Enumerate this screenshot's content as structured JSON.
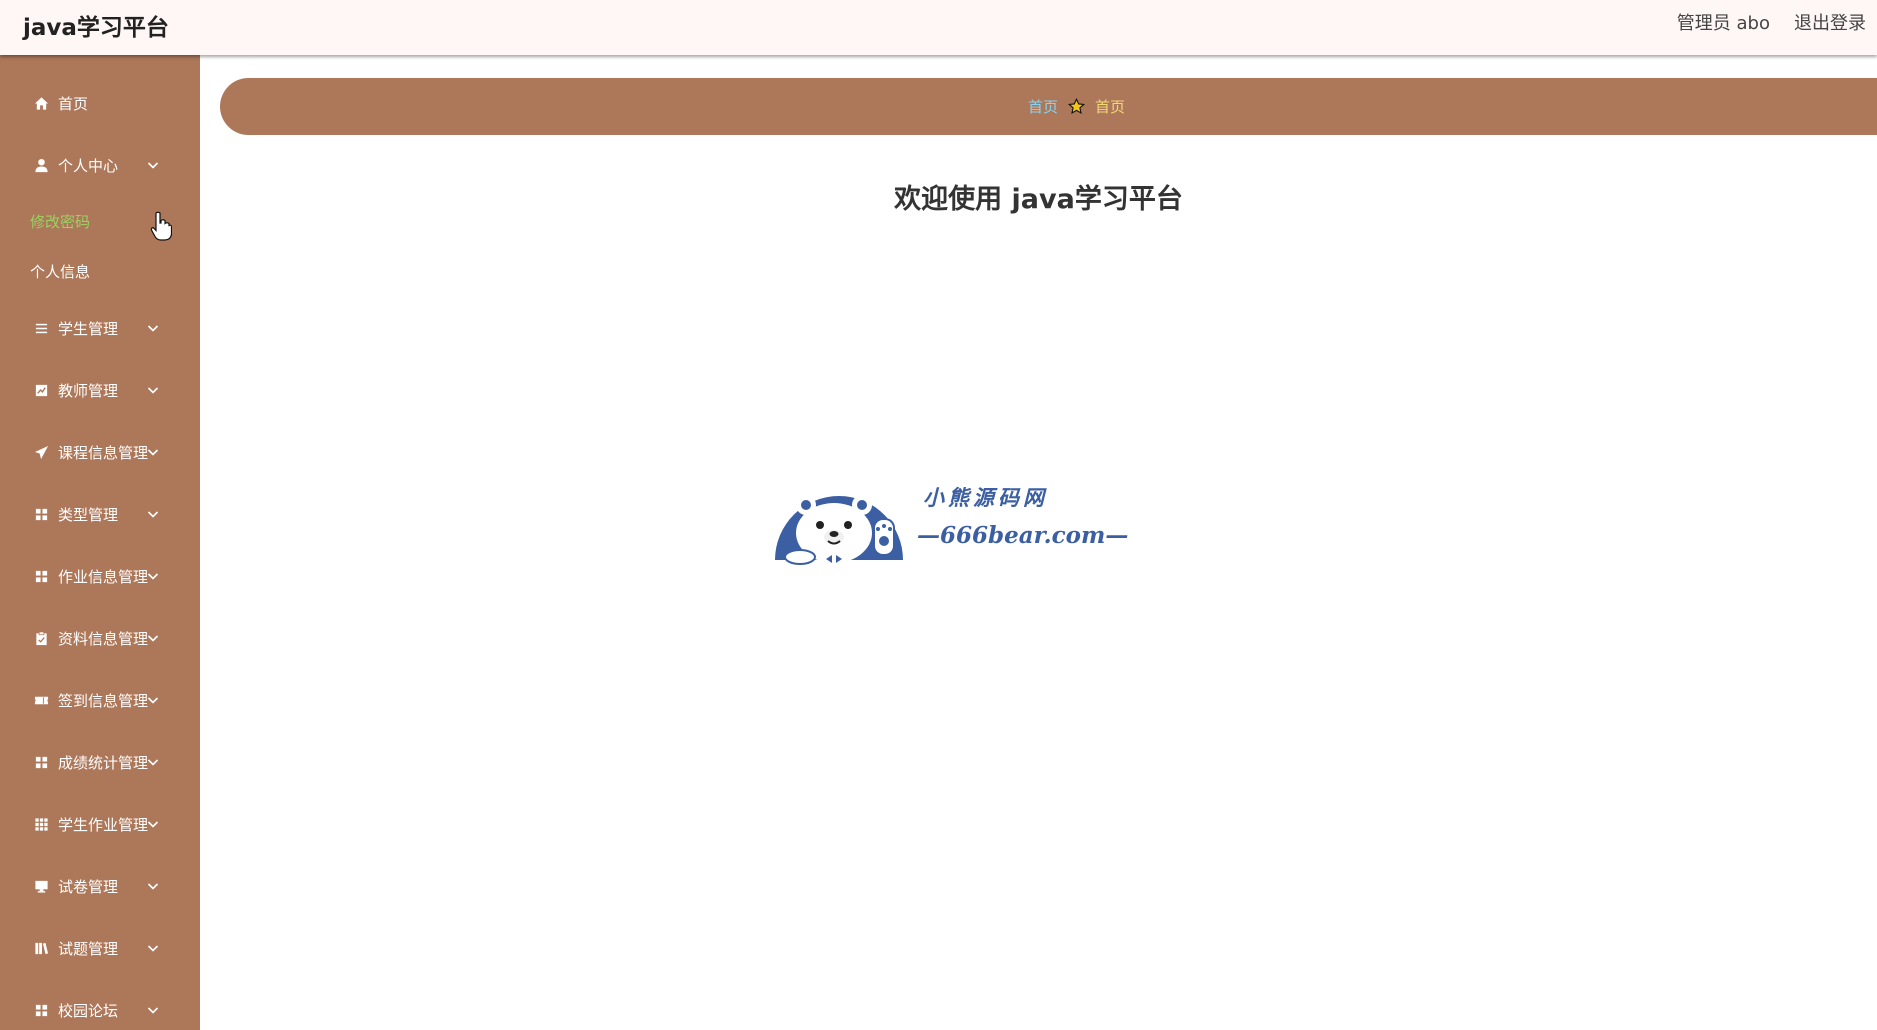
{
  "header": {
    "title": "java学习平台",
    "user_label": "管理员 abo",
    "logout_label": "退出登录"
  },
  "colors": {
    "sidebar_bg": "#ad7759",
    "active_submenu": "#9bd162",
    "crumb_home": "#87d4f2",
    "crumb_current": "#f1d977",
    "logo_blue": "#3c5fa3"
  },
  "sidebar": {
    "items": [
      {
        "label": "首页",
        "icon": "home-icon"
      },
      {
        "label": "个人中心",
        "icon": "user-icon",
        "expanded": true
      },
      {
        "label": "学生管理",
        "icon": "list-icon"
      },
      {
        "label": "教师管理",
        "icon": "chart-icon"
      },
      {
        "label": "课程信息管理",
        "icon": "send-icon"
      },
      {
        "label": "类型管理",
        "icon": "grid-icon"
      },
      {
        "label": "作业信息管理",
        "icon": "grid-icon"
      },
      {
        "label": "资料信息管理",
        "icon": "clipboard-icon"
      },
      {
        "label": "签到信息管理",
        "icon": "ticket-icon"
      },
      {
        "label": "成绩统计管理",
        "icon": "grid-icon"
      },
      {
        "label": "学生作业管理",
        "icon": "apps-icon"
      },
      {
        "label": "试卷管理",
        "icon": "monitor-icon"
      },
      {
        "label": "试题管理",
        "icon": "library-icon"
      },
      {
        "label": "校园论坛",
        "icon": "grid-icon"
      }
    ],
    "submenu": [
      {
        "label": "修改密码",
        "active": true
      },
      {
        "label": "个人信息",
        "active": false
      }
    ]
  },
  "breadcrumb": {
    "home": "首页",
    "current": "首页"
  },
  "main": {
    "welcome": "欢迎使用 java学习平台"
  },
  "watermark": {
    "line1": "小熊源码网",
    "line2": "—666bear.com—"
  }
}
